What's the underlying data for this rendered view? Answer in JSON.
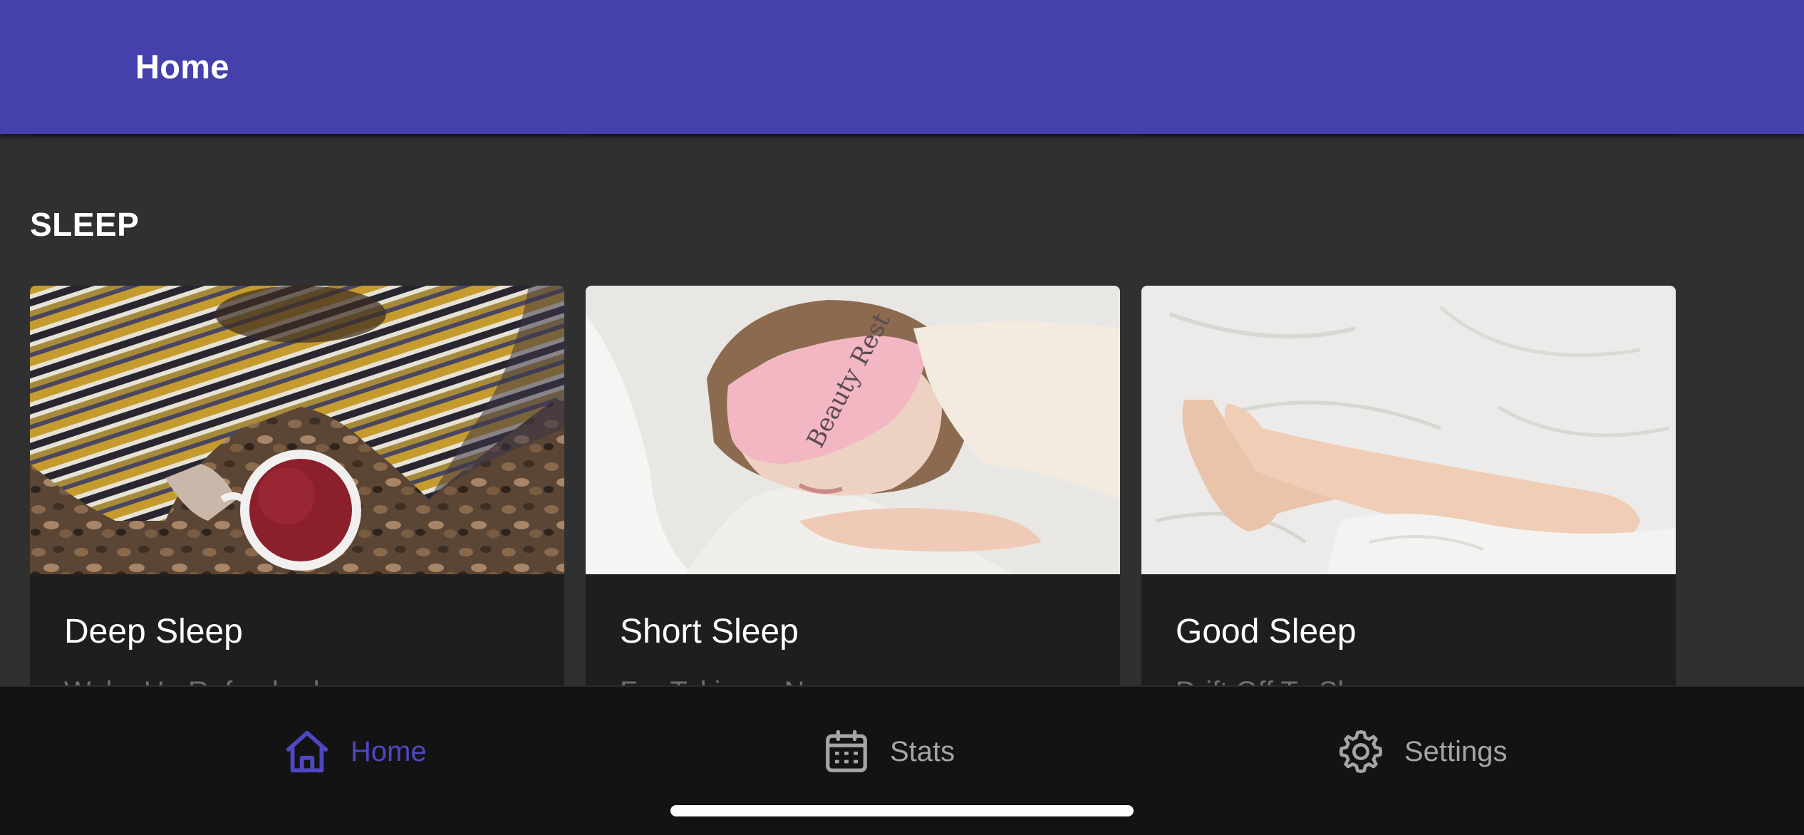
{
  "app_bar": {
    "title": "Home",
    "color": "#4540ac"
  },
  "section": {
    "title": "SLEEP"
  },
  "cards": [
    {
      "title": "Deep Sleep",
      "subtitle": "Wake Up Refreshed",
      "image": "cup-of-tea-blanket-image"
    },
    {
      "title": "Short Sleep",
      "subtitle": "For Taking a Nap",
      "image": "woman-sleeping-eye-mask-image"
    },
    {
      "title": "Good Sleep",
      "subtitle": "Drift Off To Sleep",
      "image": "feet-on-bedsheet-image"
    }
  ],
  "mask_text": "Beauty Rest",
  "bottom_nav": {
    "items": [
      {
        "label": "Home",
        "icon": "home-icon",
        "active": true
      },
      {
        "label": "Stats",
        "icon": "calendar-icon",
        "active": false
      },
      {
        "label": "Settings",
        "icon": "gear-icon",
        "active": false
      }
    ],
    "active_color": "#4f47c2",
    "inactive_color": "#a5a5a5"
  }
}
